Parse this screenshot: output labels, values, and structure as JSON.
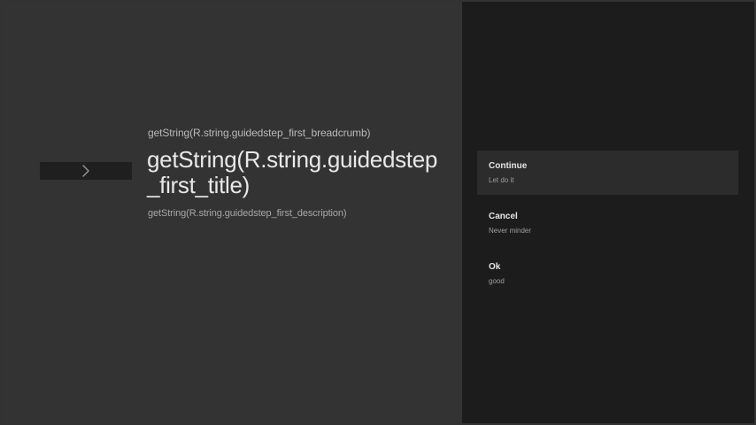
{
  "guidance": {
    "icon": "chevron-right-icon",
    "breadcrumb": "getString(R.string.guidedstep_first_breadcrumb)",
    "title": "getString(R.string.guidedstep_first_title)",
    "description": "getString(R.string.guidedstep_first_description)"
  },
  "actions": [
    {
      "title": "Continue",
      "description": "Let do it",
      "selected": true
    },
    {
      "title": "Cancel",
      "description": "Never minder",
      "selected": false
    },
    {
      "title": "Ok",
      "description": "good",
      "selected": false
    }
  ],
  "colors": {
    "guidance_background": "#333333",
    "actions_background": "#1c1c1c",
    "selected_action_background": "#2c2c2c",
    "text_primary": "#e8e8e8",
    "text_secondary": "#a8a8a8"
  }
}
